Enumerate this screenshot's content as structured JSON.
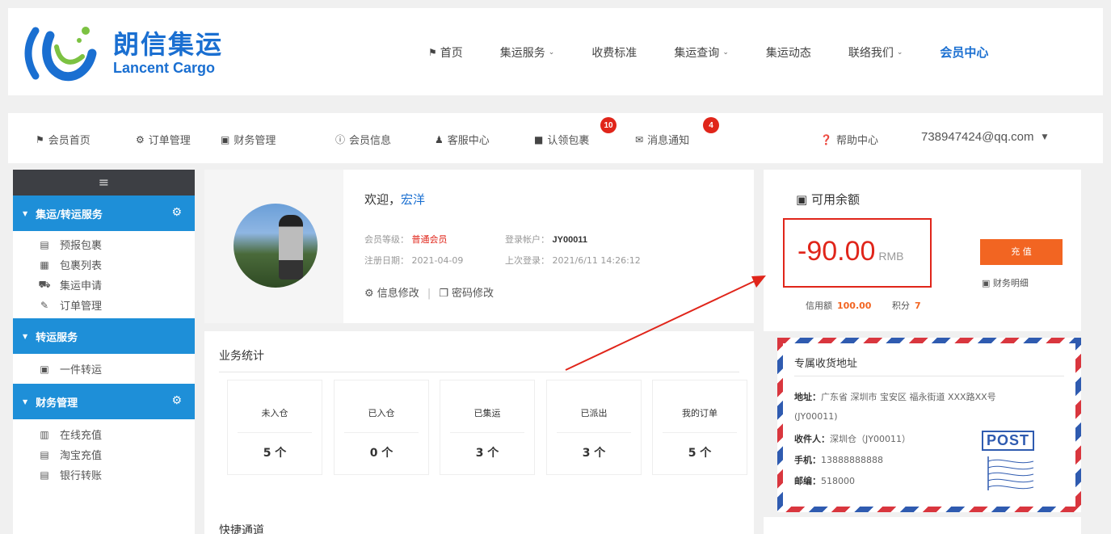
{
  "header": {
    "logo_cn": "朗信集运",
    "logo_en": "Lancent Cargo",
    "nav": [
      {
        "label": "首页",
        "home": true
      },
      {
        "label": "集运服务",
        "caret": true
      },
      {
        "label": "收费标准"
      },
      {
        "label": "集运查询",
        "caret": true
      },
      {
        "label": "集运动态"
      },
      {
        "label": "联络我们",
        "caret": true
      },
      {
        "label": "会员中心",
        "active": true
      }
    ]
  },
  "member_nav": {
    "items": [
      "会员首页",
      "订单管理",
      "财务管理",
      "会员信息",
      "客服中心",
      "认领包裹",
      "消息通知"
    ],
    "badge_claim": "10",
    "badge_msg": "4",
    "help": "帮助中心",
    "email": "738947424@qq.com"
  },
  "sidebar": {
    "menu_icon": "≡",
    "group1": "集运/转运服务",
    "group1_items": [
      "预报包裹",
      "包裹列表",
      "集运申请",
      "订单管理"
    ],
    "group2": "转运服务",
    "group2_items": [
      "一件转运"
    ],
    "group3": "财务管理",
    "group3_items": [
      "在线充值",
      "淘宝充值",
      "银行转账"
    ]
  },
  "profile": {
    "welcome": "欢迎，",
    "name": "宏洋",
    "level_label": "会员等级：",
    "level_value": "普通会员",
    "account_label": "登录帐户：",
    "account_value": "JY00011",
    "reg_label": "注册日期：",
    "reg_value": "2021-04-09",
    "last_label": "上次登录：",
    "last_value": "2021/6/11 14:26:12",
    "edit_info": "信息修改",
    "sep": "|",
    "edit_pwd": "密码修改"
  },
  "stats": {
    "title": "业务统计",
    "items": [
      {
        "label": "未入仓",
        "value": "5 个"
      },
      {
        "label": "已入仓",
        "value": "0 个"
      },
      {
        "label": "已集运",
        "value": "3 个"
      },
      {
        "label": "已派出",
        "value": "3 个"
      },
      {
        "label": "我的订单",
        "value": "5 个"
      }
    ],
    "quick": "快捷通道"
  },
  "balance": {
    "title": "可用余额",
    "amount": "-90.00",
    "unit": "RMB",
    "recharge": "充 值",
    "detail": "财务明细",
    "credit_label": "信用额",
    "credit_value": "100.00",
    "points_label": "积分",
    "points_value": "7"
  },
  "address": {
    "title": "专属收货地址",
    "addr_label": "地址：",
    "addr_value": "广东省 深圳市 宝安区 福永街道 XXX路XX号",
    "addr_value2": "(JY00011)",
    "recv_label": "收件人：",
    "recv_value": "深圳仓（JY00011）",
    "phone_label": "手机：",
    "phone_value": "13888888888",
    "zip_label": "邮编：",
    "zip_value": "518000",
    "stamp": "POST"
  },
  "colors": {
    "brand": "#1a6fd1",
    "sidebar_group": "#1e8fd8",
    "alert": "#e0251a",
    "recharge": "#f26522"
  }
}
